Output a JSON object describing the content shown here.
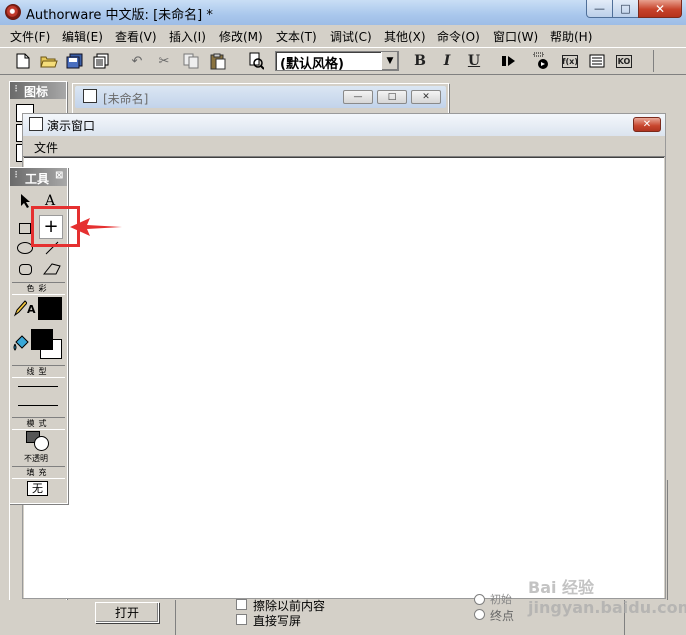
{
  "window": {
    "title": "Authorware 中文版: [未命名] *",
    "minimize": "—",
    "maximize": "□",
    "close": "✕"
  },
  "menu": [
    {
      "label": "文件(F)"
    },
    {
      "label": "编辑(E)"
    },
    {
      "label": "查看(V)"
    },
    {
      "label": "插入(I)"
    },
    {
      "label": "修改(M)"
    },
    {
      "label": "文本(T)"
    },
    {
      "label": "调试(C)"
    },
    {
      "label": "其他(X)"
    },
    {
      "label": "命令(O)"
    },
    {
      "label": "窗口(W)"
    },
    {
      "label": "帮助(H)"
    }
  ],
  "toolbar": {
    "style_selected": "(默认风格)",
    "bold": "B",
    "italic": "I",
    "underline": "U",
    "fn_label": "f(x)",
    "ko_label": "KO",
    "icons": [
      "new-file-icon",
      "open-folder-icon",
      "save-all-icon",
      "import-icon",
      "undo-icon",
      "cut-icon",
      "copy-icon",
      "paste-icon",
      "find-icon",
      "run-icon",
      "control-panel-icon",
      "functions-icon",
      "variables-icon",
      "knowledge-objects-icon"
    ]
  },
  "icons_panel": {
    "title": "图标"
  },
  "flow_window": {
    "title": "[未命名]"
  },
  "present_window": {
    "title": "演示窗口",
    "menu_file": "文件",
    "close": "✕"
  },
  "tools_panel": {
    "title": "工具",
    "close": "⊠",
    "text_tool": "A",
    "pen_letter": "A",
    "plus_tool": "+",
    "colors_label": "色彩",
    "line_type_label": "线型",
    "mode_label": "模式",
    "mode_value": "不透明",
    "fill_label": "填充",
    "fill_value": "无"
  },
  "bottom": {
    "open_button": "打开",
    "erase_previous": "擦除以前内容",
    "direct_to_screen": "直接写屏",
    "radio_start": "初始",
    "radio_end": "终点"
  },
  "watermark": "Bai 经验  jingyan.baidu.com",
  "colors": {
    "highlight": "#e53030",
    "arrow": "#e53030",
    "face": "#d4d0c8"
  }
}
